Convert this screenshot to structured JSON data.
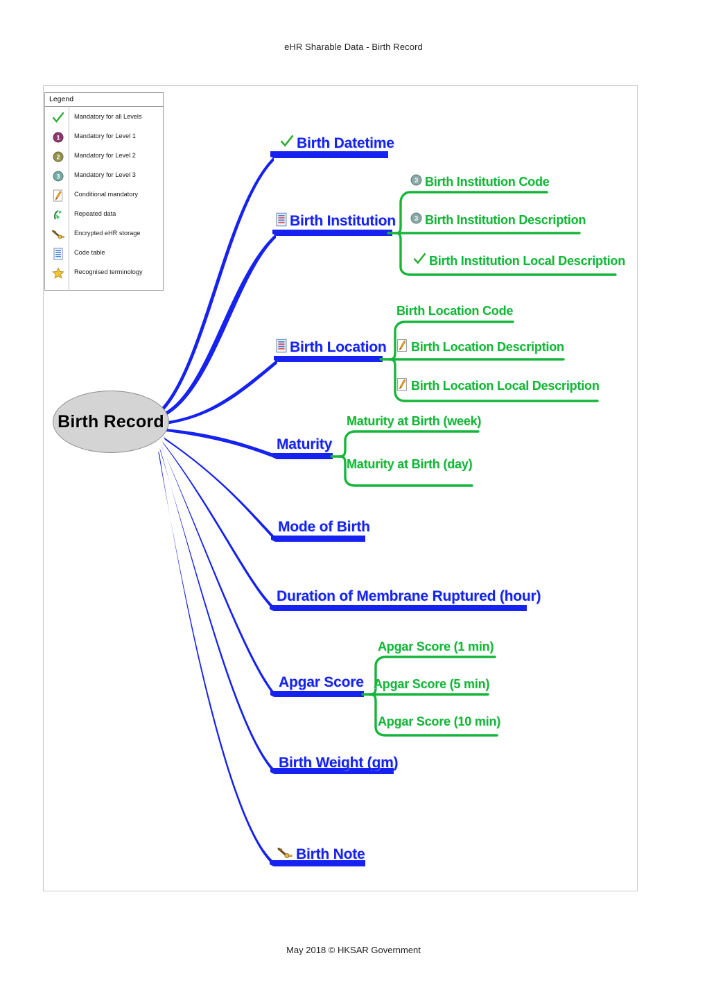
{
  "header": {
    "title": "eHR Sharable Data - Birth Record"
  },
  "footer": {
    "text": "May 2018 © HKSAR Government"
  },
  "colors": {
    "branch_blue": "#1522f0",
    "child_green": "#15b53a",
    "root_fill": "#d4d4d4",
    "check_green": "#2cae35"
  },
  "legend": {
    "title": "Legend",
    "items": [
      {
        "icon": "check-icon",
        "label": "Mandatory for all Levels"
      },
      {
        "icon": "level-1-circle-icon",
        "label": "Mandatory for Level 1"
      },
      {
        "icon": "level-2-circle-icon",
        "label": "Mandatory for Level 2"
      },
      {
        "icon": "level-3-circle-icon",
        "label": "Mandatory for Level 3"
      },
      {
        "icon": "pencil-note-icon",
        "label": "Conditional mandatory"
      },
      {
        "icon": "repeated-data-icon",
        "label": "Repeated data"
      },
      {
        "icon": "encrypted-storage-icon",
        "label": "Encrypted eHR storage"
      },
      {
        "icon": "code-table-icon",
        "label": "Code table"
      },
      {
        "icon": "star-icon",
        "label": "Recognised terminology"
      }
    ]
  },
  "mindmap": {
    "root": {
      "label": "Birth Record"
    },
    "branches": [
      {
        "label": "Birth Datetime",
        "icon": "check-icon",
        "children": []
      },
      {
        "label": "Birth Institution",
        "icon": "code-table-icon",
        "children": [
          {
            "label": "Birth Institution Code",
            "icon": "level-3-circle-icon"
          },
          {
            "label": "Birth Institution Description",
            "icon": "level-3-circle-icon"
          },
          {
            "label": "Birth Institution Local Description",
            "icon": "check-icon"
          }
        ]
      },
      {
        "label": "Birth Location",
        "icon": "code-table-icon",
        "children": [
          {
            "label": "Birth Location Code",
            "icon": "none"
          },
          {
            "label": "Birth Location Description",
            "icon": "pencil-note-icon"
          },
          {
            "label": "Birth Location Local Description",
            "icon": "pencil-note-icon"
          }
        ]
      },
      {
        "label": "Maturity",
        "icon": "none",
        "children": [
          {
            "label": "Maturity at Birth (week)",
            "icon": "none"
          },
          {
            "label": "Maturity at Birth (day)",
            "icon": "none"
          }
        ]
      },
      {
        "label": "Mode of Birth",
        "icon": "none",
        "children": []
      },
      {
        "label": "Duration of Membrane Ruptured (hour)",
        "icon": "none",
        "children": []
      },
      {
        "label": "Apgar Score",
        "icon": "none",
        "children": [
          {
            "label": "Apgar Score (1 min)",
            "icon": "none"
          },
          {
            "label": "Apgar Score (5 min)",
            "icon": "none"
          },
          {
            "label": "Apgar Score (10 min)",
            "icon": "none"
          }
        ]
      },
      {
        "label": "Birth Weight (gm)",
        "icon": "none",
        "children": []
      },
      {
        "label": "Birth Note",
        "icon": "encrypted-storage-icon",
        "children": []
      }
    ]
  }
}
